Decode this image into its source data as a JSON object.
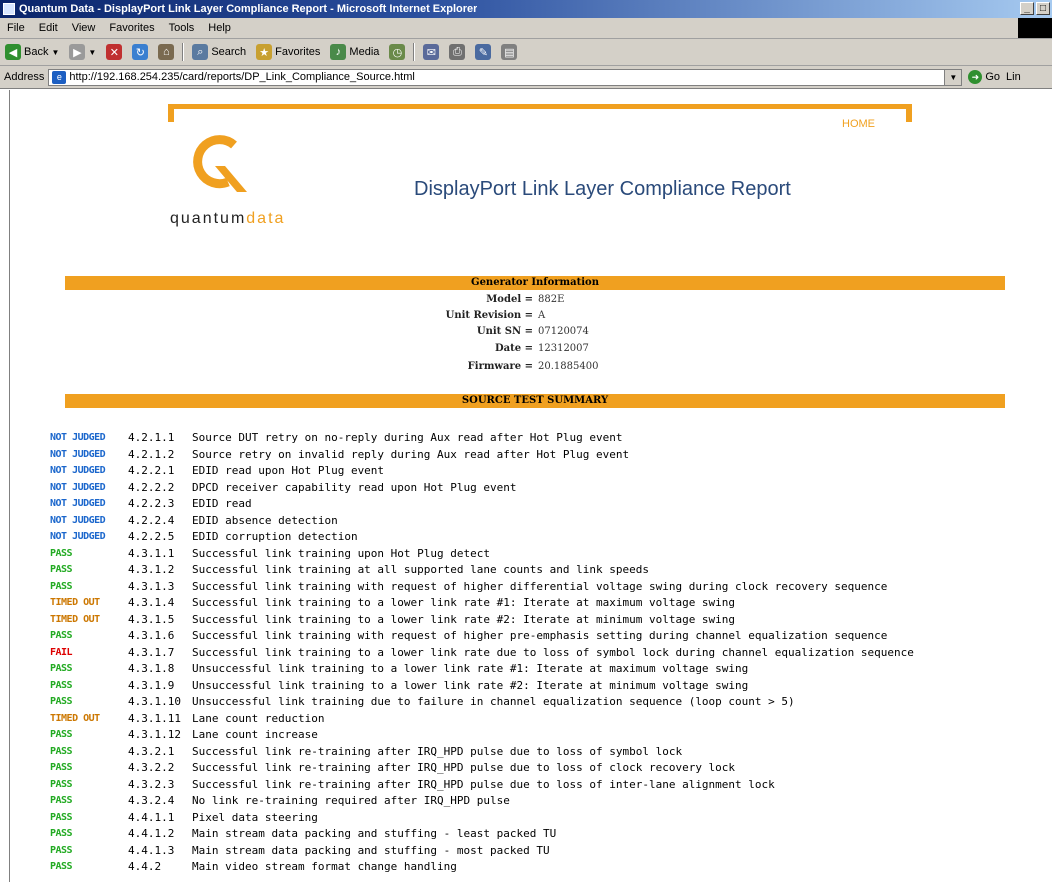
{
  "window": {
    "title": "Quantum Data - DisplayPort Link Layer Compliance Report - Microsoft Internet Explorer",
    "controls": [
      "_",
      "□"
    ]
  },
  "menu": [
    "File",
    "Edit",
    "View",
    "Favorites",
    "Tools",
    "Help"
  ],
  "toolbar": {
    "back": "Back",
    "search": "Search",
    "favorites": "Favorites",
    "media": "Media"
  },
  "address": {
    "label": "Address",
    "url": "http://192.168.254.235/card/reports/DP_Link_Compliance_Source.html",
    "go": "Go",
    "links": "Lin"
  },
  "page": {
    "home": "HOME",
    "logo": {
      "word1": "quantum",
      "word2": "data"
    },
    "title": "DisplayPort Link Layer Compliance Report",
    "generator_heading": "Generator Information",
    "generator": [
      {
        "label": "Model =",
        "value": "882E"
      },
      {
        "label": "Unit Revision =",
        "value": "A"
      },
      {
        "label": "Unit SN =",
        "value": "07120074"
      },
      {
        "label": "Date =",
        "value": "12312007"
      },
      {
        "label": "Firmware =",
        "value": "20.1885400"
      }
    ],
    "summary_heading": "SOURCE TEST SUMMARY",
    "results": [
      {
        "status": "NOT JUDGED",
        "kind": "notjudged",
        "id": "4.2.1.1",
        "desc": "Source DUT retry on no-reply during Aux read after Hot Plug event"
      },
      {
        "status": "NOT JUDGED",
        "kind": "notjudged",
        "id": "4.2.1.2",
        "desc": "Source retry on invalid reply during Aux read after Hot Plug event"
      },
      {
        "status": "NOT JUDGED",
        "kind": "notjudged",
        "id": "4.2.2.1",
        "desc": "EDID read upon Hot Plug event"
      },
      {
        "status": "NOT JUDGED",
        "kind": "notjudged",
        "id": "4.2.2.2",
        "desc": "DPCD receiver capability read upon Hot Plug event"
      },
      {
        "status": "NOT JUDGED",
        "kind": "notjudged",
        "id": "4.2.2.3",
        "desc": "EDID read"
      },
      {
        "status": "NOT JUDGED",
        "kind": "notjudged",
        "id": "4.2.2.4",
        "desc": "EDID absence detection"
      },
      {
        "status": "NOT JUDGED",
        "kind": "notjudged",
        "id": "4.2.2.5",
        "desc": "EDID corruption detection"
      },
      {
        "status": "PASS",
        "kind": "pass",
        "id": "4.3.1.1",
        "desc": "Successful link training upon Hot Plug detect"
      },
      {
        "status": "PASS",
        "kind": "pass",
        "id": "4.3.1.2",
        "desc": "Successful link training at all supported lane counts and link speeds"
      },
      {
        "status": "PASS",
        "kind": "pass",
        "id": "4.3.1.3",
        "desc": "Successful link training with request of higher differential voltage swing during clock recovery sequence"
      },
      {
        "status": "TIMED OUT",
        "kind": "timed",
        "id": "4.3.1.4",
        "desc": "Successful link training to a lower link rate #1: Iterate at maximum voltage swing"
      },
      {
        "status": "TIMED OUT",
        "kind": "timed",
        "id": "4.3.1.5",
        "desc": "Successful link training to a lower link rate #2: Iterate at minimum voltage swing"
      },
      {
        "status": "PASS",
        "kind": "pass",
        "id": "4.3.1.6",
        "desc": "Successful link training with request of higher pre-emphasis setting during channel equalization sequence"
      },
      {
        "status": "FAIL",
        "kind": "fail",
        "id": "4.3.1.7",
        "desc": "Successful link training to a lower link rate due to loss of symbol lock during channel equalization sequence"
      },
      {
        "status": "PASS",
        "kind": "pass",
        "id": "4.3.1.8",
        "desc": "Unsuccessful link training to a lower link rate #1: Iterate at maximum voltage swing"
      },
      {
        "status": "PASS",
        "kind": "pass",
        "id": "4.3.1.9",
        "desc": "Unsuccessful link training to a lower link rate #2: Iterate at minimum voltage swing"
      },
      {
        "status": "PASS",
        "kind": "pass",
        "id": "4.3.1.10",
        "desc": "Unsuccessful link training due to failure in channel equalization sequence (loop count > 5)"
      },
      {
        "status": "TIMED OUT",
        "kind": "timed",
        "id": "4.3.1.11",
        "desc": "Lane count reduction"
      },
      {
        "status": "PASS",
        "kind": "pass",
        "id": "4.3.1.12",
        "desc": "Lane count increase"
      },
      {
        "status": "PASS",
        "kind": "pass",
        "id": "4.3.2.1",
        "desc": "Successful link re-training after IRQ_HPD pulse due to loss of symbol lock"
      },
      {
        "status": "PASS",
        "kind": "pass",
        "id": "4.3.2.2",
        "desc": "Successful link re-training after IRQ_HPD pulse due to loss of clock recovery lock"
      },
      {
        "status": "PASS",
        "kind": "pass",
        "id": "4.3.2.3",
        "desc": "Successful link re-training after IRQ_HPD pulse due to loss of inter-lane alignment lock"
      },
      {
        "status": "PASS",
        "kind": "pass",
        "id": "4.3.2.4",
        "desc": "No link re-training required after IRQ_HPD pulse"
      },
      {
        "status": "PASS",
        "kind": "pass",
        "id": "4.4.1.1",
        "desc": "Pixel data steering"
      },
      {
        "status": "PASS",
        "kind": "pass",
        "id": "4.4.1.2",
        "desc": "Main stream data packing and stuffing - least packed TU"
      },
      {
        "status": "PASS",
        "kind": "pass",
        "id": "4.4.1.3",
        "desc": "Main stream data packing and stuffing - most packed TU"
      },
      {
        "status": "PASS",
        "kind": "pass",
        "id": "4.4.2",
        "desc": "Main video stream format change handling"
      }
    ]
  },
  "colors": {
    "accent": "#f0a020",
    "pass": "#22aa22",
    "fail": "#dd0000",
    "timed_out": "#cc7700",
    "not_judged": "#1a66cc",
    "title": "#2a4a7a"
  }
}
